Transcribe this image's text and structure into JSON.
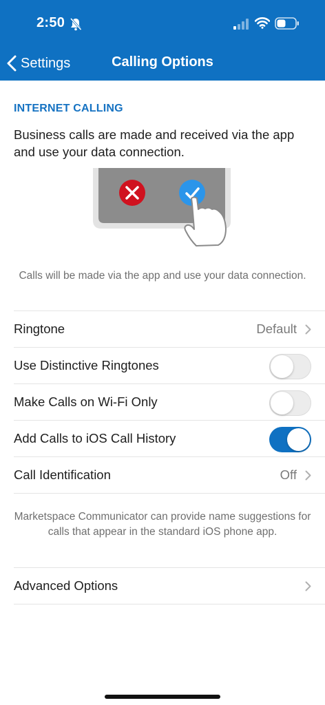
{
  "status_bar": {
    "time": "2:50"
  },
  "nav": {
    "back_label": "Settings",
    "title": "Calling Options"
  },
  "section": {
    "label": "INTERNET CALLING",
    "description": "Business calls are made and received via the app and use your data connection."
  },
  "note_mode": "Calls will be made via the app and use your data connection.",
  "rows": {
    "ringtone": {
      "label": "Ringtone",
      "value": "Default"
    },
    "distinctive": {
      "label": "Use Distinctive Ringtones",
      "on": false
    },
    "wifi_only": {
      "label": "Make Calls on Wi-Fi Only",
      "on": false
    },
    "call_history": {
      "label": "Add Calls to iOS Call History",
      "on": true
    },
    "call_id": {
      "label": "Call Identification",
      "value": "Off"
    },
    "advanced": {
      "label": "Advanced Options"
    }
  },
  "note_call_id": "Marketspace Communicator can provide name suggestions for calls that appear in the standard iOS phone app.",
  "colors": {
    "brand": "#0f71c2",
    "decline": "#d0121f",
    "accept": "#2b95ea"
  }
}
